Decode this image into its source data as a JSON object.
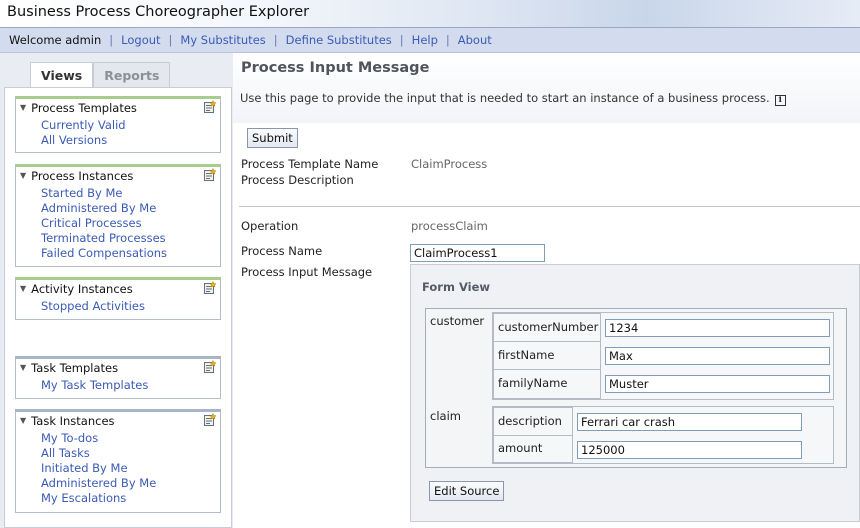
{
  "header": {
    "app_title": "Business Process Choreographer Explorer",
    "welcome": "Welcome admin",
    "links": [
      "Logout",
      "My Substitutes",
      "Define Substitutes",
      "Help",
      "About"
    ],
    "separator": "|"
  },
  "sidebar": {
    "tabs": [
      "Views",
      "Reports"
    ],
    "active_tab": "Views",
    "sections": [
      {
        "title": "Process Templates",
        "items": [
          "Currently Valid",
          "All Versions"
        ]
      },
      {
        "title": "Process Instances",
        "items": [
          "Started By Me",
          "Administered By Me",
          "Critical Processes",
          "Terminated Processes",
          "Failed Compensations"
        ]
      },
      {
        "title": "Activity Instances",
        "items": [
          "Stopped Activities"
        ]
      },
      {
        "title": "Task Templates",
        "items": [
          "My Task Templates"
        ]
      },
      {
        "title": "Task Instances",
        "items": [
          "My To-dos",
          "All Tasks",
          "Initiated By Me",
          "Administered By Me",
          "My Escalations"
        ]
      }
    ],
    "icons": {
      "collapse": "triangle-down-icon",
      "edit": "edit-view-icon"
    }
  },
  "main": {
    "title": "Process Input Message",
    "description": "Use this page to provide the input that is needed to start an instance of a business process.",
    "submit_label": "Submit",
    "template_name_label": "Process Template Name",
    "template_name_value": "ClaimProcess",
    "description_label": "Process Description",
    "operation_label": "Operation",
    "operation_value": "processClaim",
    "process_name_label": "Process Name",
    "process_name_value": "ClaimProcess1",
    "input_message_label": "Process Input Message"
  },
  "form_view": {
    "title": "Form View",
    "customer_label": "customer",
    "customer_number_label": "customerNumber",
    "customer_number_value": "1234",
    "first_name_label": "firstName",
    "first_name_value": "Max",
    "family_name_label": "familyName",
    "family_name_value": "Muster",
    "claim_label": "claim",
    "claim_description_label": "description",
    "claim_description_value": "Ferrari car crash",
    "amount_label": "amount",
    "amount_value": "125000",
    "edit_source_label": "Edit Source"
  },
  "colors": {
    "link": "#3a5bb5",
    "navbar": "#d3dbee",
    "section_accent": "#a8cc8e"
  }
}
